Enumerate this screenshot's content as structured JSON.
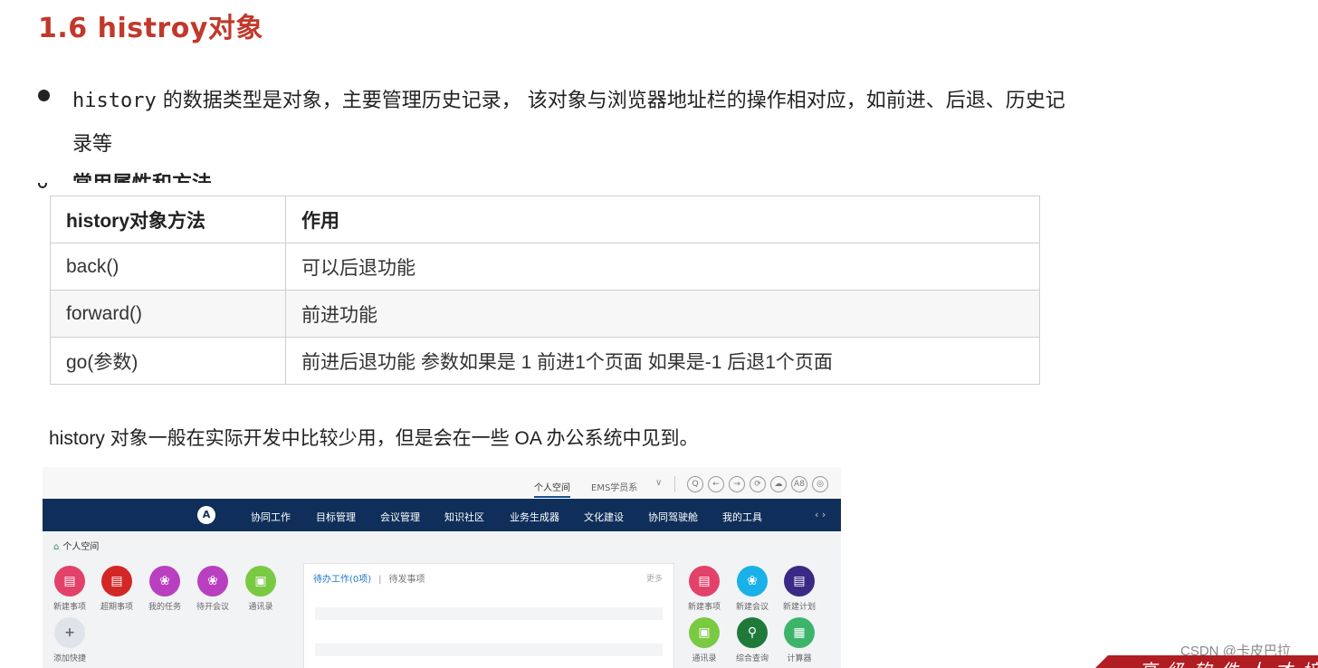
{
  "title": "1.6 histroy对象",
  "bullet1": {
    "line1_code": "history",
    "line1_text": " 的数据类型是对象，主要管理历史记录，  该对象与浏览器地址栏的操作相对应，如前进、后退、历史记",
    "line2_text": "录等"
  },
  "bullet2_clipped": "常用属性和方法",
  "table": {
    "headers": [
      "history对象方法",
      "作用"
    ],
    "rows": [
      [
        "back()",
        "可以后退功能"
      ],
      [
        "forward()",
        "前进功能"
      ],
      [
        "go(参数)",
        "前进后退功能 参数如果是 1 前进1个页面 如果是-1 后退1个页面"
      ]
    ]
  },
  "note": "history 对象一般在实际开发中比较少用，但是会在一些 OA 办公系统中见到。",
  "oa": {
    "top_tab": "个人空间",
    "ems": "EMS学员系",
    "chevron": "∨",
    "top_icons": [
      "Q",
      "←",
      "→",
      "⟳",
      "☁",
      "A8",
      "◎"
    ],
    "logo": "A",
    "nav": [
      "协同工作",
      "目标管理",
      "会议管理",
      "知识社区",
      "业务生成器",
      "文化建设",
      "协同驾驶舱",
      "我的工具"
    ],
    "nav_arrows": "‹ ›",
    "crumb": "个人空间",
    "apps_left": [
      {
        "label": "新建事项",
        "glyph": "▤",
        "color": "#e2416a"
      },
      {
        "label": "超期事项",
        "glyph": "▤",
        "color": "#d32727"
      },
      {
        "label": "我的任务",
        "glyph": "❀",
        "color": "#b93fc1"
      },
      {
        "label": "待开会议",
        "glyph": "❀",
        "color": "#b93fc1"
      },
      {
        "label": "通讯录",
        "glyph": "▣",
        "color": "#7ac943"
      },
      {
        "label": "添加快捷",
        "glyph": "+",
        "color": "#dfe3ea"
      }
    ],
    "panel": {
      "todo": "待办工作(0项)",
      "separator": "|",
      "pending": "待发事项",
      "more": "更多"
    },
    "apps_right": [
      {
        "label": "新建事项",
        "glyph": "▤",
        "color": "#e2416a"
      },
      {
        "label": "新建会议",
        "glyph": "❀",
        "color": "#1ab0e8"
      },
      {
        "label": "新建计划",
        "glyph": "▤",
        "color": "#3a2a86"
      },
      {
        "label": "通讯录",
        "glyph": "▣",
        "color": "#7ac943"
      },
      {
        "label": "综合查询",
        "glyph": "⚲",
        "color": "#1f7a3a"
      },
      {
        "label": "计算器",
        "glyph": "▦",
        "color": "#3cb56b"
      }
    ]
  },
  "watermark": "CSDN @卡皮巴拉",
  "footer_brand": "高级软件人才培训"
}
